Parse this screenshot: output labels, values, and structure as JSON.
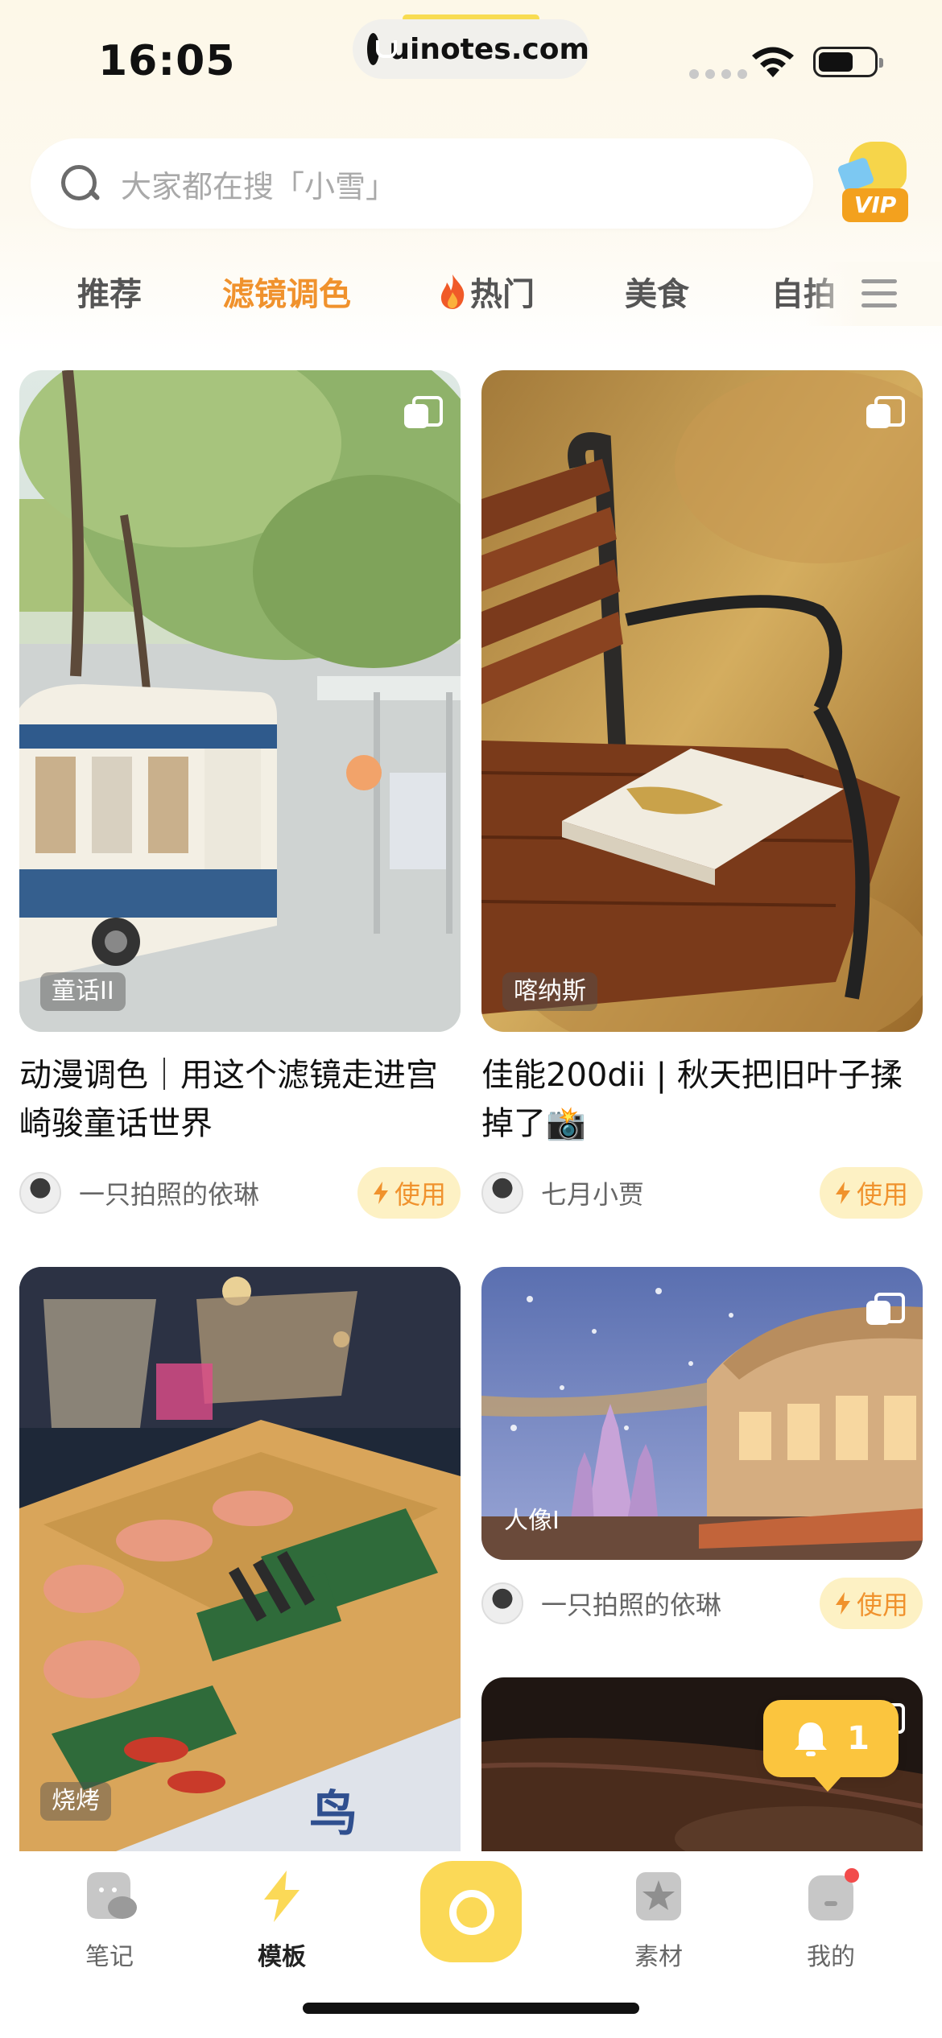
{
  "status_bar": {
    "time": "16:05",
    "url": "uinotes.com",
    "icons": [
      "signal-dots-icon",
      "wifi-icon",
      "battery-icon"
    ]
  },
  "search": {
    "placeholder": "大家都在搜「小雪」",
    "vip_label": "VIP"
  },
  "tabs": [
    {
      "label": "推荐",
      "active": false
    },
    {
      "label": "滤镜调色",
      "active": true
    },
    {
      "label": "热门",
      "active": false,
      "icon": "flame-icon"
    },
    {
      "label": "美食",
      "active": false
    },
    {
      "label": "自拍",
      "active": false
    }
  ],
  "cards": [
    {
      "tag": "童话II",
      "title_line1": "动漫调色｜用这个滤镜走进宫",
      "title_line2": "崎骏童话世界",
      "author": "一只拍照的依琳",
      "use_label": "使用"
    },
    {
      "tag": "喀纳斯",
      "title_line1": "佳能200dii | 秋天把旧叶子揉",
      "title_line2": "掉了📸",
      "author": "七月小贾",
      "use_label": "使用"
    },
    {
      "tag": "烧烤"
    },
    {
      "tag": "人像I",
      "author": "一只拍照的依琳",
      "use_label": "使用"
    }
  ],
  "notification": {
    "count": "1"
  },
  "bottom_nav": [
    {
      "label": "笔记",
      "active": false
    },
    {
      "label": "模板",
      "active": true
    },
    {
      "label": "素材",
      "active": false
    },
    {
      "label": "我的",
      "active": false,
      "badge": true
    }
  ],
  "colors": {
    "accent": "#f0922d",
    "brand_yellow": "#fbd957",
    "use_button_bg": "#fdf1c4"
  }
}
